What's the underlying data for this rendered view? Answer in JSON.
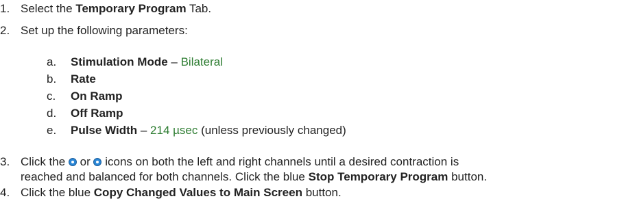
{
  "steps": [
    {
      "num": "1.",
      "pre": "Select the ",
      "bold": "Temporary Program",
      "post": " Tab."
    },
    {
      "num": "2.",
      "text": "Set up the following parameters:"
    },
    {
      "num": "3.",
      "line1_a": "Click the ",
      "line1_b": " or ",
      "line1_c": " icons on both the left and right channels until a desired contraction is",
      "line2_pre": "reached and balanced for both channels. Click the blue ",
      "line2_bold": "Stop Temporary Program",
      "line2_post": " button."
    },
    {
      "num": "4.",
      "pre": "Click the blue ",
      "bold": "Copy Changed Values to Main Screen",
      "post": " button."
    }
  ],
  "params": [
    {
      "letter": "a.",
      "label": "Stimulation Mode",
      "sep": " – ",
      "value": "Bilateral",
      "note": ""
    },
    {
      "letter": "b.",
      "label": "Rate",
      "sep": "",
      "value": "",
      "note": ""
    },
    {
      "letter": "c.",
      "label": "On Ramp",
      "sep": "",
      "value": "",
      "note": ""
    },
    {
      "letter": "d.",
      "label": "Off Ramp",
      "sep": "",
      "value": "",
      "note": ""
    },
    {
      "letter": "e.",
      "label": "Pulse Width",
      "sep": " – ",
      "value": "214 µsec",
      "note": " (unless previously changed)"
    }
  ],
  "icons": {
    "decrease": "decrease-icon",
    "increase": "increase-icon",
    "color": "#2a86d6"
  },
  "colors": {
    "text": "#222222",
    "value": "#2e7d32"
  }
}
